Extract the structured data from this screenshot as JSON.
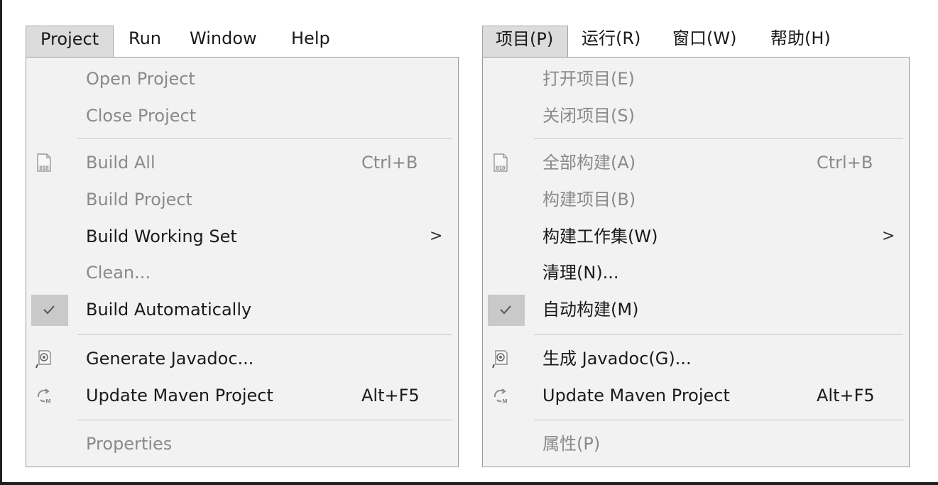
{
  "english": {
    "menubar": {
      "project": "Project",
      "run": "Run",
      "window": "Window",
      "help": "Help"
    },
    "menu": {
      "open_project": "Open Project",
      "close_project": "Close Project",
      "build_all": "Build All",
      "build_all_shortcut": "Ctrl+B",
      "build_project": "Build Project",
      "build_working_set": "Build Working Set",
      "submenu_arrow": ">",
      "clean": "Clean...",
      "build_automatically": "Build Automatically",
      "generate_javadoc": "Generate Javadoc...",
      "update_maven_project": "Update Maven Project",
      "update_maven_shortcut": "Alt+F5",
      "properties": "Properties"
    }
  },
  "chinese": {
    "menubar": {
      "project": "项目(P)",
      "run": "运行(R)",
      "window": "窗口(W)",
      "help": "帮助(H)"
    },
    "menu": {
      "open_project": "打开项目(E)",
      "close_project": "关闭项目(S)",
      "build_all": "全部构建(A)",
      "build_all_shortcut": "Ctrl+B",
      "build_project": "构建项目(B)",
      "build_working_set": "构建工作集(W)",
      "submenu_arrow": ">",
      "clean": "清理(N)...",
      "build_automatically": "自动构建(M)",
      "generate_javadoc": "生成 Javadoc(G)...",
      "update_maven_project": "Update Maven Project",
      "update_maven_shortcut": "Alt+F5",
      "properties": "属性(P)"
    }
  },
  "icons": {
    "build_all": "binary-file-icon",
    "build_automatically": "checkmark-icon",
    "generate_javadoc": "javadoc-icon",
    "update_maven_project": "maven-update-icon"
  },
  "colors": {
    "menu_background": "#f2f2f2",
    "enabled_text": "#1a1a1a",
    "disabled_text": "#8a8a8a",
    "active_menubar_background": "#dcdcdc",
    "checked_background": "#c9c9c9"
  }
}
